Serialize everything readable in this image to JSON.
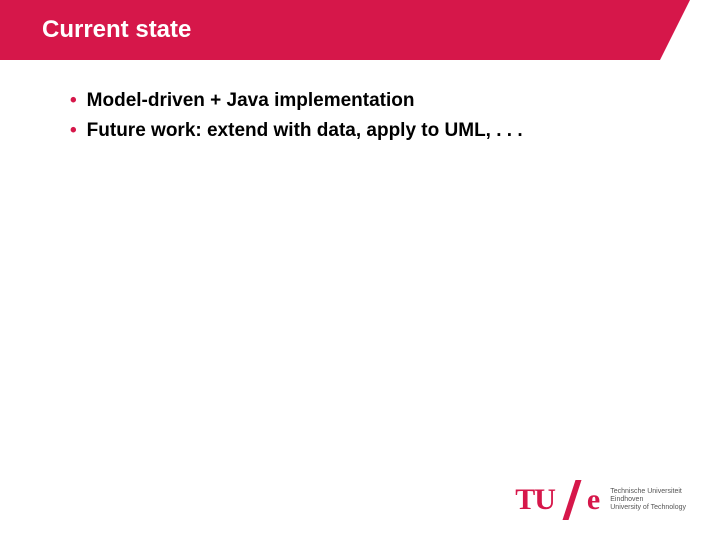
{
  "title": "Current state",
  "bullets": [
    "Model-driven + Java implementation",
    "Future work: extend with data, apply to UML, . . ."
  ],
  "logo": {
    "tu": "TU",
    "e": "e",
    "lines": [
      "Technische Universiteit",
      "Eindhoven",
      "University of Technology"
    ]
  }
}
